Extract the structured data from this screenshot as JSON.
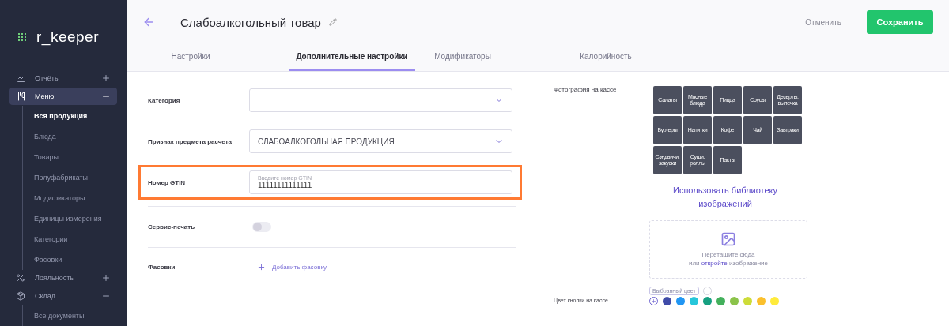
{
  "sidebar": {
    "logo": "r_keeper",
    "items": [
      {
        "label": "Отчёты",
        "expanded": false,
        "selected": false
      },
      {
        "label": "Меню",
        "expanded": true,
        "selected": true,
        "children": [
          {
            "label": "Вся продукция",
            "selected": true
          },
          {
            "label": "Блюда",
            "selected": false
          },
          {
            "label": "Товары",
            "selected": false
          },
          {
            "label": "Полуфабрикаты",
            "selected": false
          },
          {
            "label": "Модификаторы",
            "selected": false
          },
          {
            "label": "Единицы измерения",
            "selected": false
          },
          {
            "label": "Категории",
            "selected": false
          },
          {
            "label": "Фасовки",
            "selected": false
          }
        ]
      },
      {
        "label": "Лояльность",
        "expanded": false,
        "selected": false
      },
      {
        "label": "Склад",
        "expanded": true,
        "selected": false,
        "children": [
          {
            "label": "Все документы",
            "selected": false
          }
        ]
      }
    ]
  },
  "header": {
    "title": "Слабоалкогольный товар",
    "cancel": "Отменить",
    "save": "Сохранить"
  },
  "tabs": [
    {
      "label": "Настройки",
      "selected": false
    },
    {
      "label": "Дополнительные настройки",
      "selected": true
    },
    {
      "label": "Модификаторы",
      "selected": false
    },
    {
      "label": "Калорийность",
      "selected": false
    }
  ],
  "form": [
    {
      "kind": "select",
      "label": "Категория",
      "highlighted": false
    },
    {
      "kind": "select",
      "label": "Признак предмета расчета",
      "value": "СЛАБОАЛКОГОЛЬНАЯ ПРОДУКЦИЯ",
      "highlighted": false
    },
    {
      "kind": "input",
      "label": "Номер GTIN",
      "placeholder": "Введите номер GTIN",
      "value": "11111111111111",
      "highlighted": true
    },
    {
      "kind": "toggle",
      "label": "Сервис-печать",
      "on": false,
      "highlighted": false
    },
    {
      "kind": "link",
      "label": "Фасовки",
      "link": "Добавить фасовку",
      "highlighted": false
    }
  ],
  "photo": {
    "label": "Фотография на кассе",
    "tiles": [
      "Салаты",
      "Мясные блюда",
      "Пицца",
      "Соусы",
      "Десерты, выпечка",
      "Бургеры",
      "Напитки",
      "Кофе",
      "Чай",
      "Завтраки",
      "Сэндвичи, закуски",
      "Суши, роллы",
      "Пасты"
    ],
    "library_link": "Использовать библиотеку изображений",
    "drop_text": "Перетащите сюда",
    "drop_or": "или",
    "drop_link": "откройте",
    "drop_tail": "изображение"
  },
  "button_color": {
    "label": "Цвет кнопки на кассе",
    "chip": "Выбранный цвет",
    "swatches": [
      {
        "kind": "custom",
        "color": "#ffffff",
        "selected": true
      },
      {
        "kind": "swatch",
        "color": "#3f4ba8",
        "selected": false
      },
      {
        "kind": "swatch",
        "color": "#2196f3",
        "selected": false
      },
      {
        "kind": "swatch",
        "color": "#26c6da",
        "selected": false
      },
      {
        "kind": "swatch",
        "color": "#17a081",
        "selected": false
      },
      {
        "kind": "swatch",
        "color": "#43b05c",
        "selected": false
      },
      {
        "kind": "swatch",
        "color": "#8bc34a",
        "selected": false
      },
      {
        "kind": "swatch",
        "color": "#cddc39",
        "selected": false
      },
      {
        "kind": "swatch",
        "color": "#fbc02d",
        "selected": false
      },
      {
        "kind": "swatch",
        "color": "#ffeb3b",
        "selected": false
      }
    ]
  }
}
